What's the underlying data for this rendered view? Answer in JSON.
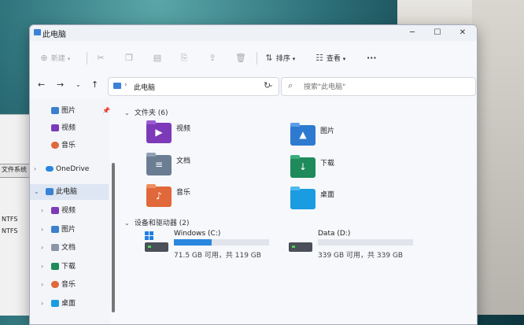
{
  "window": {
    "title": "此电脑"
  },
  "win_controls": {
    "minimize": "─",
    "maximize": "☐",
    "close": "✕"
  },
  "toolbar": {
    "new_label": "新建",
    "sort_label": "排序",
    "view_label": "查看",
    "more_label": "···"
  },
  "address": {
    "path": "此电脑",
    "search_placeholder": "搜索\"此电脑\""
  },
  "sidebar": {
    "items": [
      {
        "label": "图片"
      },
      {
        "label": "视频"
      },
      {
        "label": "音乐"
      },
      {
        "label": "OneDrive"
      },
      {
        "label": "此电脑"
      },
      {
        "label": "视频"
      },
      {
        "label": "图片"
      },
      {
        "label": "文档"
      },
      {
        "label": "下载"
      },
      {
        "label": "音乐"
      },
      {
        "label": "桌面"
      }
    ]
  },
  "folders_section": {
    "title": "文件夹 (6)"
  },
  "folders": [
    {
      "label": "视频"
    },
    {
      "label": "图片"
    },
    {
      "label": "文档"
    },
    {
      "label": "下载"
    },
    {
      "label": "音乐"
    },
    {
      "label": "桌面"
    }
  ],
  "devices_section": {
    "title": "设备和驱动器 (2)"
  },
  "drives": [
    {
      "name": "Windows (C:)",
      "free_text": "71.5 GB 可用，共 119 GB",
      "used_fraction": 0.4
    },
    {
      "name": "Data (D:)",
      "free_text": "339 GB 可用，共 339 GB",
      "used_fraction": 0.0
    }
  ],
  "background_window": {
    "lines": [
      "文件系统",
      "NTFS",
      "NTFS"
    ]
  },
  "colors": {
    "accent": "#2a86de",
    "folder_video": "#7d3ab8",
    "folder_music": "#e0683a"
  }
}
